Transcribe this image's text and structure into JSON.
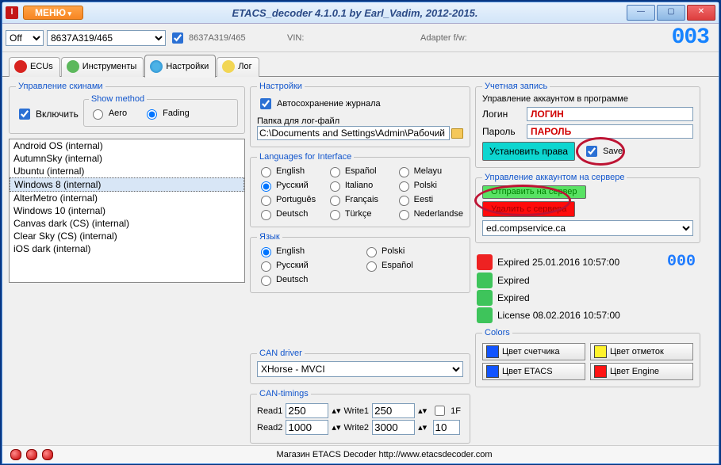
{
  "title": "ETACS_decoder 4.1.0.1 by Earl_Vadim, 2012-2015.",
  "menu_label": "МЕНЮ",
  "top": {
    "off": "Off",
    "combo_val": "8637A319/465",
    "vin_dim": "8637A319/465",
    "vin_label": "VIN:",
    "adapter_label": "Adapter f/w:",
    "digits": "003"
  },
  "tabs": {
    "ecu": "ECUs",
    "instr": "Инструменты",
    "settings": "Настройки",
    "log": "Лог"
  },
  "skins": {
    "legend": "Управление скинами",
    "enable": "Включить",
    "show_legend": "Show method",
    "aero": "Aero",
    "fading": "Fading",
    "items": [
      "Android OS (internal)",
      "AutumnSky (internal)",
      "Ubuntu (internal)",
      "Windows 8 (internal)",
      "AlterMetro (internal)",
      "Windows 10 (internal)",
      "Canvas dark (CS) (internal)",
      "Clear Sky (CS) (internal)",
      "iOS dark (internal)"
    ]
  },
  "settings": {
    "legend": "Настройки",
    "autosave": "Автосохранение журнала",
    "logfolder_label": "Папка для лог-файл",
    "logfolder": "C:\\Documents and Settings\\Admin\\Рабочий стс"
  },
  "langs_if": {
    "legend": "Languages for Interface",
    "items": [
      "English",
      "Español",
      "Melayu",
      "Русский",
      "Italiano",
      "Polski",
      "Português",
      "Français",
      "Eesti",
      "Deutsch",
      "Türkçe",
      "Nederlandse"
    ]
  },
  "lang": {
    "legend": "Язык",
    "items": [
      "English",
      "Polski",
      "Русский",
      "Español",
      "Deutsch"
    ]
  },
  "can": {
    "legend": "CAN driver",
    "driver": "XHorse - MVCI"
  },
  "can_tim": {
    "legend": "CAN-timings",
    "read1_l": "Read1",
    "read1": "250",
    "write1_l": "Write1",
    "write1": "250",
    "read2_l": "Read2",
    "read2": "1000",
    "write2_l": "Write2",
    "write2": "3000",
    "oneF": "1F",
    "oneF_val": "10"
  },
  "acct": {
    "legend": "Учетная запись",
    "prog_legend": "Управление аккаунтом в программе",
    "login_l": "Логин",
    "login_v": "ЛОГИН",
    "pass_l": "Пароль",
    "pass_v": "ПАРОЛЬ",
    "rights_btn": "Установить права",
    "save": "Save",
    "srv_legend": "Управление аккаунтом на сервере",
    "send_srv": "Отправить на сервер",
    "del_srv": "Удалить с сервера",
    "server_combo": "ed.compservice.ca"
  },
  "lic": {
    "r1": "Expired 25.01.2016 10:57:00",
    "r2": "Expired",
    "r3": "Expired",
    "r4": "License 08.02.2016 10:57:00",
    "digits": "000"
  },
  "colors": {
    "legend": "Colors",
    "counter": "Цвет счетчика",
    "marks": "Цвет отметок",
    "etacs": "Цвет ETACS",
    "engine": "Цвет Engine"
  },
  "status": "Магазин ETACS Decoder http://www.etacsdecoder.com"
}
